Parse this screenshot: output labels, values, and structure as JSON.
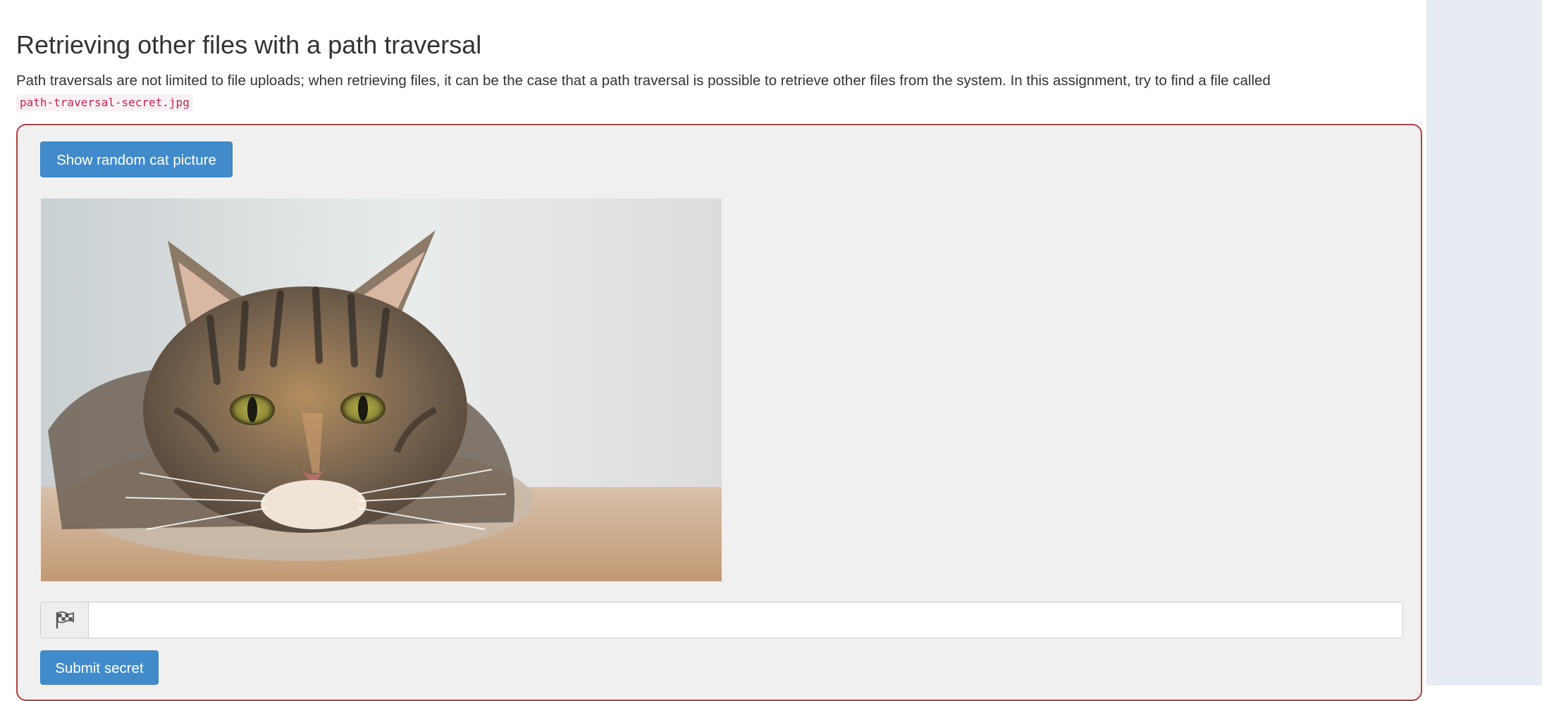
{
  "lesson": {
    "title": "Retrieving other files with a path traversal",
    "description": "Path traversals are not limited to file uploads; when retrieving files, it can be the case that a path traversal is possible to retrieve other files from the system. In this assignment, try to find a file called",
    "target_file": "path-traversal-secret.jpg"
  },
  "assignment": {
    "cat_button_label": "Show random cat picture",
    "secret_input": {
      "value": "",
      "placeholder": "",
      "icon": "flag-checkered-icon"
    },
    "submit_button_label": "Submit secret",
    "border_color": "#a94442"
  },
  "colors": {
    "primary_button": "#428bca",
    "panel_background": "#f0f0f0",
    "code_text": "#c7254e"
  }
}
